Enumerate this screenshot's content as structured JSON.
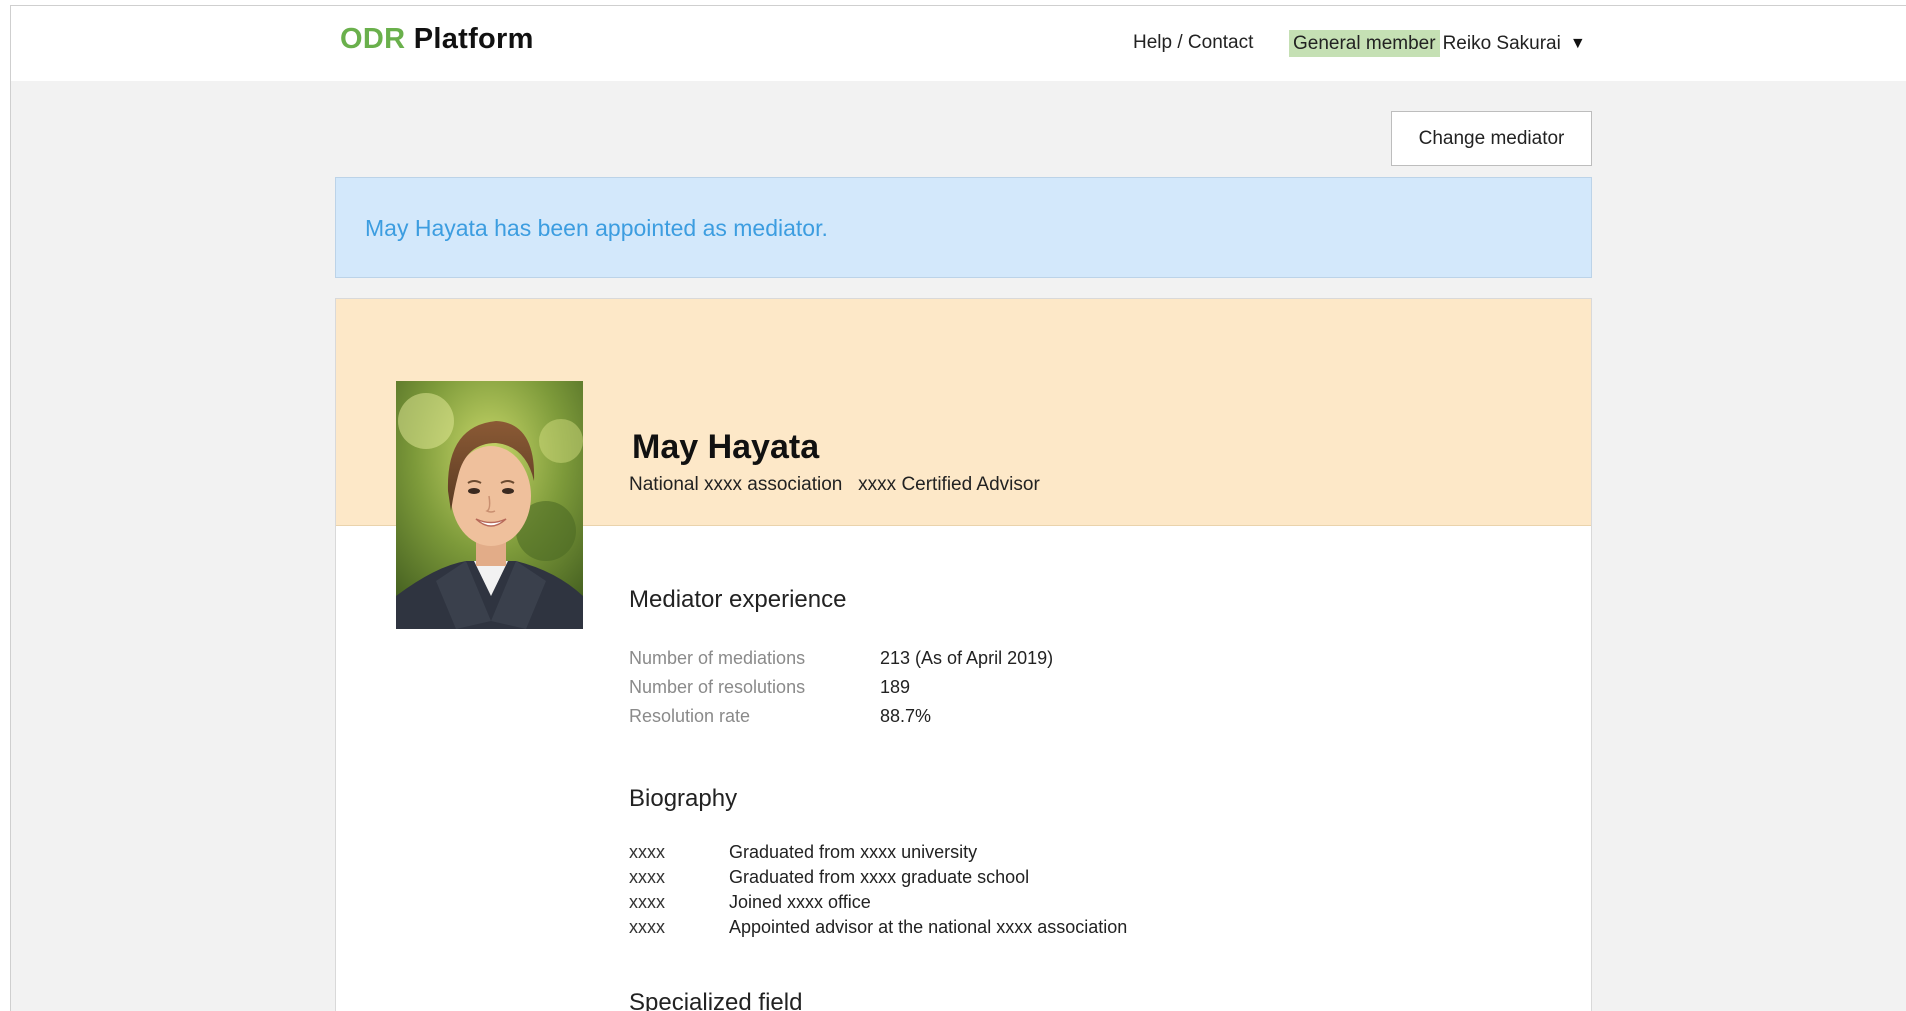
{
  "header": {
    "logo_accent": "ODR",
    "logo_rest": "Platform",
    "help_link": "Help / Contact",
    "member_type": "General member",
    "user_name": "Reiko Sakurai",
    "caret_icon": "caret-down-icon",
    "accent_color": "#6ab04c",
    "badge_color": "#c5e0b4"
  },
  "actions": {
    "change_mediator_label": "Change mediator"
  },
  "notice": {
    "message": "May Hayata has been appointed as mediator.",
    "bg_color": "#d3e8fb",
    "text_color": "#3c9de0"
  },
  "profile": {
    "photo_icon": "mediator-portrait-photo",
    "name": "May Hayata",
    "affiliation": "National xxxx association   xxxx Certified Advisor",
    "band_color": "#fde8c8"
  },
  "experience": {
    "title": "Mediator experience",
    "rows": [
      {
        "label": "Number of mediations",
        "value": "213 (As of April 2019)"
      },
      {
        "label": "Number of resolutions",
        "value": "189"
      },
      {
        "label": "Resolution rate",
        "value": "88.7%"
      }
    ]
  },
  "biography": {
    "title": "Biography",
    "rows": [
      {
        "year": "xxxx",
        "text": "Graduated from xxxx university"
      },
      {
        "year": "xxxx",
        "text": "Graduated from xxxx graduate school"
      },
      {
        "year": "xxxx",
        "text": "Joined xxxx office"
      },
      {
        "year": "xxxx",
        "text": "Appointed advisor at the national xxxx association"
      }
    ]
  },
  "specialized": {
    "title": "Specialized field"
  }
}
